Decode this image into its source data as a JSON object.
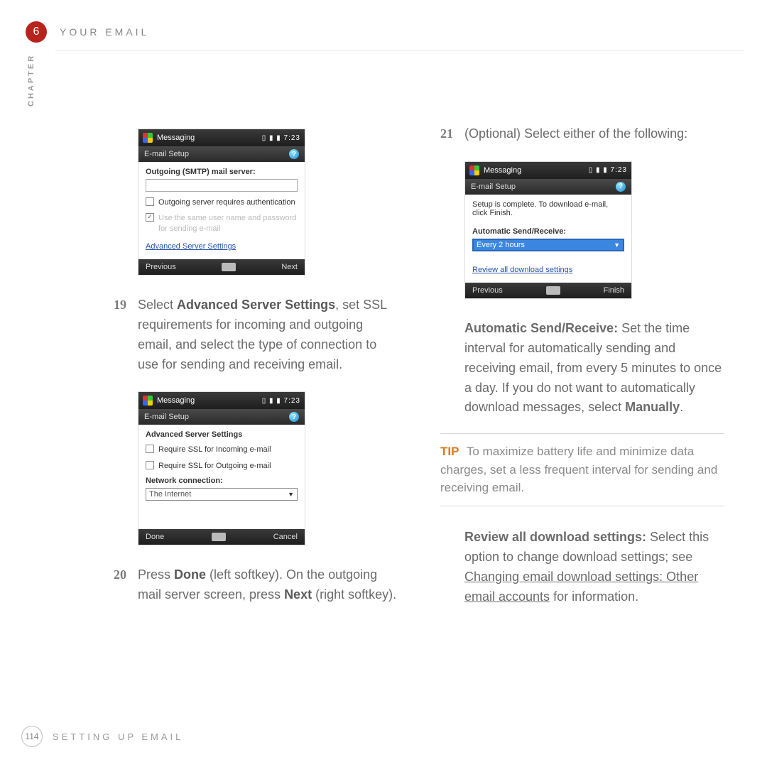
{
  "chapter": {
    "number": "6",
    "title_letters": "YOUR EMAIL",
    "side_label": "CHAPTER"
  },
  "footer": {
    "page": "114",
    "section": "SETTING UP EMAIL"
  },
  "ss_common": {
    "app": "Messaging",
    "clock": "7:23",
    "sub": "E-mail Setup",
    "help": "?",
    "prev": "Previous",
    "next": "Next",
    "done": "Done",
    "cancel": "Cancel",
    "finish": "Finish"
  },
  "ss1": {
    "label": "Outgoing (SMTP) mail server:",
    "check1": "Outgoing server requires authentication",
    "check2": "Use the same user name and password for sending e-mail",
    "link": "Advanced Server Settings"
  },
  "ss2": {
    "heading": "Advanced Server Settings",
    "check1": "Require SSL for Incoming e-mail",
    "check2": "Require SSL for Outgoing e-mail",
    "net_label": "Network connection:",
    "net_value": "The Internet"
  },
  "ss3": {
    "text": "Setup is complete.  To download e-mail, click Finish.",
    "label": "Automatic Send/Receive:",
    "value": "Every 2 hours",
    "link": "Review all download settings"
  },
  "steps": {
    "s19_num": "19",
    "s19_a": "Select ",
    "s19_b": "Advanced Server Settings",
    "s19_c": ", set SSL requirements for incoming and outgoing email, and select the type of connection to use for sending and receiving email.",
    "s20_num": "20",
    "s20_a": "Press ",
    "s20_b": "Done",
    "s20_c": " (left softkey). On the outgoing mail server screen, press ",
    "s20_d": "Next",
    "s20_e": " (right softkey).",
    "s21_num": "21",
    "s21_text": "(Optional) Select either of the following:"
  },
  "para_auto": {
    "head": "Automatic Send/Receive:",
    "body1": " Set the time interval for automatically sending and receiving email, from every 5 minutes to once a day. If you do not want to automatically download messages, select ",
    "body2": "Manually",
    "body3": "."
  },
  "tip": {
    "label": "TIP",
    "text": " To maximize battery life and minimize data charges, set a less frequent interval for sending and receiving email."
  },
  "para_review": {
    "head": "Review all download settings:",
    "a": " Select this option to change download settings; see ",
    "link": "Changing email download settings: Other email accounts",
    "b": " for information."
  }
}
